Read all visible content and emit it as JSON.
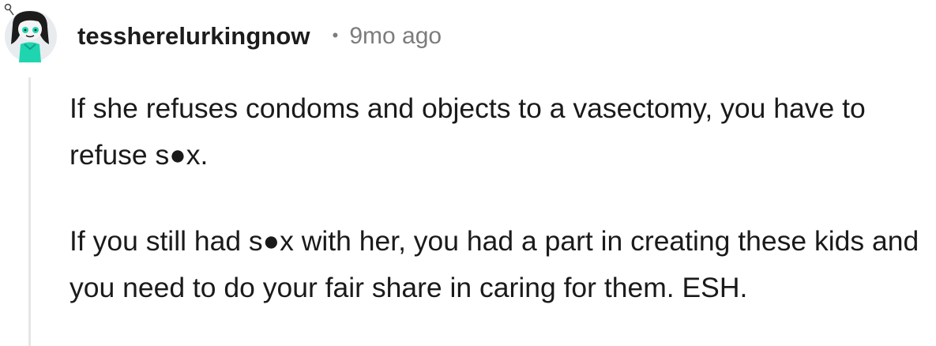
{
  "comment": {
    "avatar": {
      "icon": "user-avatar-icon",
      "accent_color": "#1fd5b0",
      "hair_color": "#1c1c1c",
      "bg_color": "#e9ecef"
    },
    "username": "tessherelurkingnow",
    "separator": "•",
    "timestamp": "9mo ago",
    "paragraphs": [
      "If she refuses condoms and objects to a vasectomy, you have to refuse s●x.",
      "If you still had s●x with her, you had a part in creating these kids and you need to do your fair share in caring for them. ESH."
    ]
  }
}
